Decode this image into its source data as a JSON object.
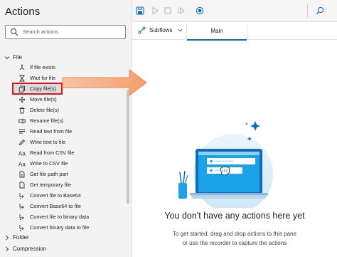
{
  "panel": {
    "title": "Actions",
    "search_placeholder": "Search actions"
  },
  "groups": [
    {
      "label": "File",
      "expanded": true
    },
    {
      "label": "Folder",
      "expanded": false
    },
    {
      "label": "Compression",
      "expanded": false
    }
  ],
  "actions": [
    {
      "label": "If file exists",
      "icon": "if-branch-icon"
    },
    {
      "label": "Wait for file",
      "icon": "hourglass-icon"
    },
    {
      "label": "Copy file(s)",
      "icon": "copy-icon",
      "highlighted": true
    },
    {
      "label": "Move file(s)",
      "icon": "move-arrows-icon"
    },
    {
      "label": "Delete file(s)",
      "icon": "trash-icon"
    },
    {
      "label": "Rename file(s)",
      "icon": "rename-icon"
    },
    {
      "label": "Read text from file",
      "icon": "read-text-icon"
    },
    {
      "label": "Write text to file",
      "icon": "write-pencil-icon"
    },
    {
      "label": "Read from CSV file",
      "icon": "text-aa-icon"
    },
    {
      "label": "Write to CSV file",
      "icon": "text-aa-icon"
    },
    {
      "label": "Get file path part",
      "icon": "file-path-icon"
    },
    {
      "label": "Get temporary file",
      "icon": "temp-file-icon"
    },
    {
      "label": "Convert file to Base64",
      "icon": "convert-icon"
    },
    {
      "label": "Convert Base64 to file",
      "icon": "convert-icon"
    },
    {
      "label": "Convert file to binary data",
      "icon": "convert-icon"
    },
    {
      "label": "Convert binary data to file",
      "icon": "convert-icon"
    }
  ],
  "toolbar": {
    "icons": [
      "save-icon",
      "run-icon",
      "stop-icon",
      "step-icon",
      "record-icon",
      "search-icon"
    ]
  },
  "tabs": {
    "subflows_label": "Subflows",
    "main_label": "Main"
  },
  "empty_state": {
    "title": "You don't have any actions here yet",
    "line1": "To get started, drag and drop actions to this pane",
    "line2": "or use the recorder to capture the actions"
  },
  "colors": {
    "accent": "#0f6cbd",
    "highlight_border": "#e81123",
    "pointer_arrow": "#f5a97a",
    "illustration_screen": "#1aa3e8"
  }
}
